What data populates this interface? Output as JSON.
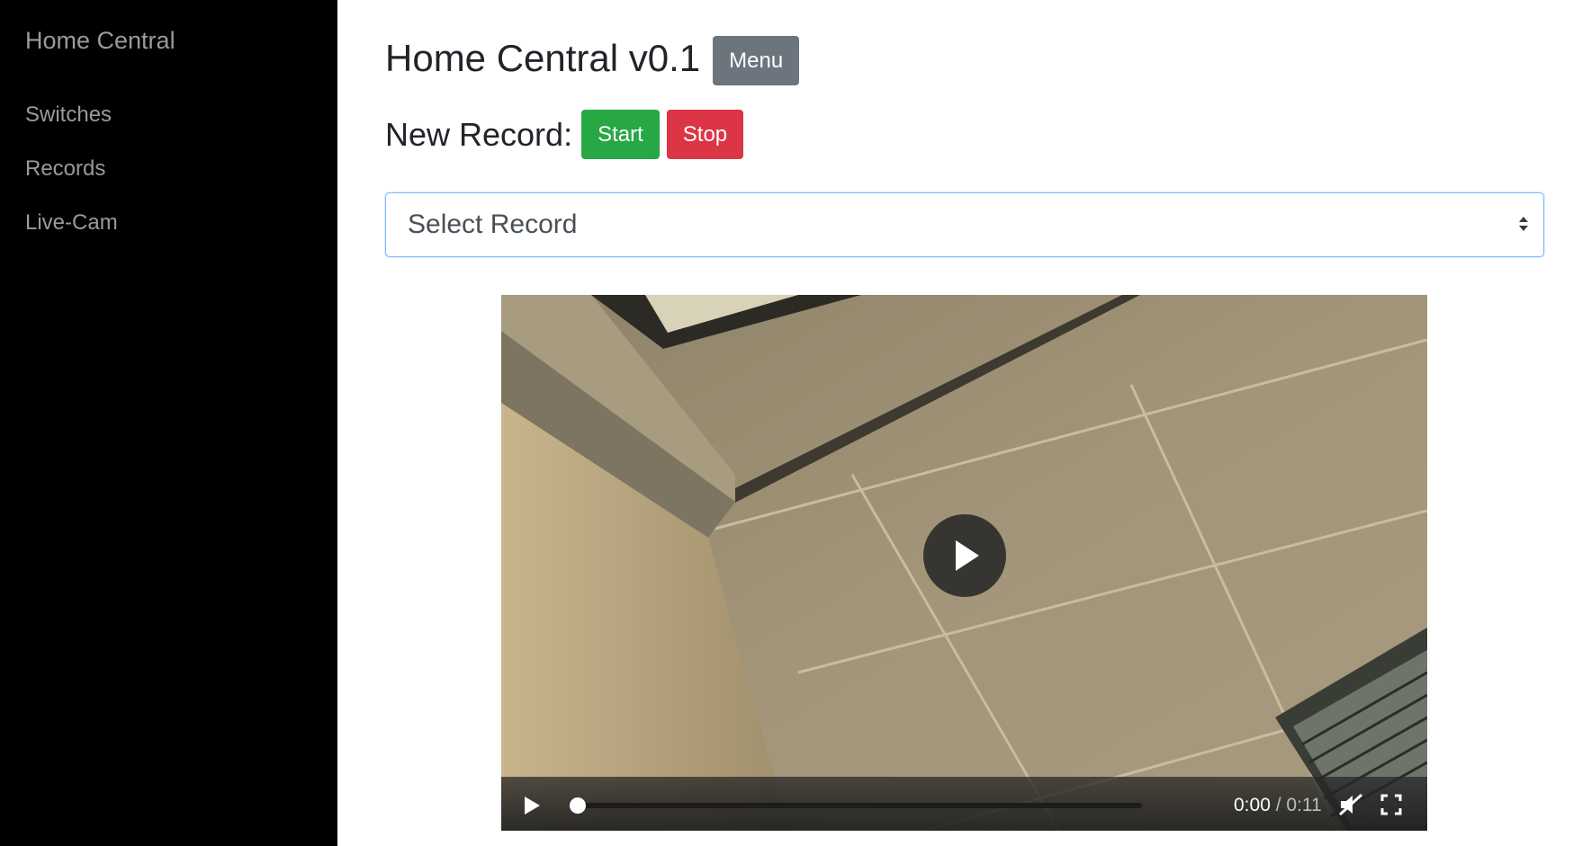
{
  "sidebar": {
    "brand": "Home Central",
    "items": [
      {
        "label": "Switches"
      },
      {
        "label": "Records"
      },
      {
        "label": "Live-Cam"
      }
    ]
  },
  "header": {
    "title": "Home Central v0.1",
    "menu_label": "Menu"
  },
  "record": {
    "label": "New Record:",
    "start_label": "Start",
    "stop_label": "Stop"
  },
  "select": {
    "selected": "Select Record"
  },
  "video": {
    "current_time": "0:00",
    "separator": " / ",
    "duration": "0:11",
    "progress": 0,
    "muted": true
  },
  "colors": {
    "sidebar_bg": "#000000",
    "sidebar_text": "#9a9a9a",
    "menu_button": "#6c757d",
    "start_button": "#28a745",
    "stop_button": "#dc3545",
    "select_border": "#80bdff"
  }
}
